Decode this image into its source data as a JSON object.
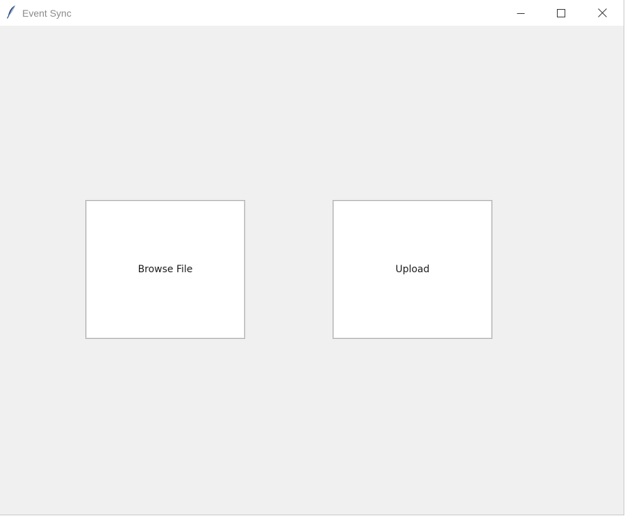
{
  "window": {
    "title": "Event Sync",
    "app_icon": "feather-icon",
    "controls": {
      "minimize_icon": "minimize-icon",
      "maximize_icon": "maximize-icon",
      "close_icon": "close-icon"
    }
  },
  "main": {
    "buttons": [
      {
        "label": "Browse File"
      },
      {
        "label": "Upload"
      }
    ]
  },
  "colors": {
    "background": "#f0f0f0",
    "titlebar": "#ffffff",
    "button_face": "#ffffff",
    "button_border": "#adadad",
    "title_text": "#8a8a8a"
  }
}
